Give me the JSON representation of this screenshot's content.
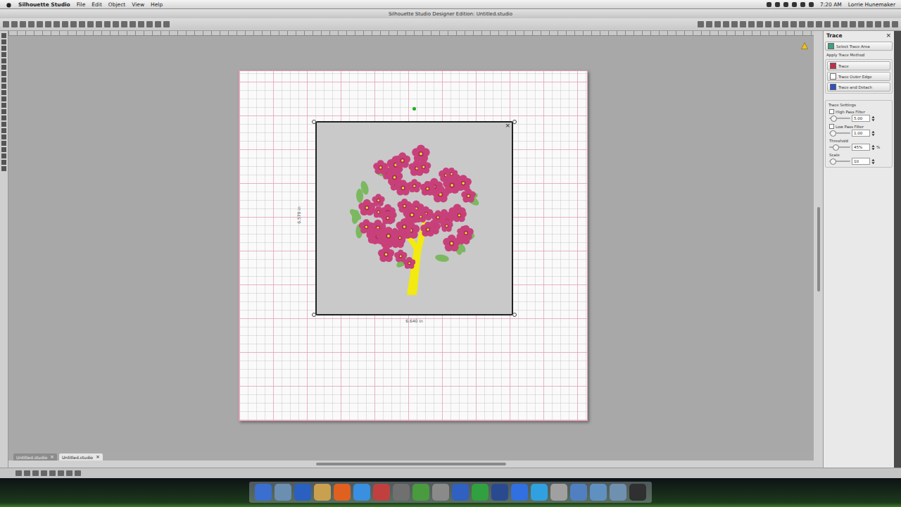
{
  "menubar": {
    "app": "Silhouette Studio",
    "menus": [
      "File",
      "Edit",
      "Object",
      "View",
      "Help"
    ],
    "clock": "7:20 AM",
    "user": "Lorrie Hunemaker"
  },
  "window": {
    "title": "Silhouette Studio Designer Edition: Untitled.studio"
  },
  "canvas": {
    "width_label": "6.640 in",
    "height_label": "6.570 in"
  },
  "trace_panel": {
    "title": "Trace",
    "close": "×",
    "select_button": "Select Trace Area",
    "method_heading": "Apply Trace Method",
    "methods": [
      {
        "label": "Trace",
        "color": "#c0304a"
      },
      {
        "label": "Trace Outer Edge",
        "color": "#ffffff"
      },
      {
        "label": "Trace and Detach",
        "color": "#3050c0"
      }
    ],
    "settings_heading": "Trace Settings",
    "settings": [
      {
        "label": "High Pass Filter",
        "kind": "checkbox",
        "checked": false,
        "value": "5.00",
        "level": 0.1,
        "suffix": ""
      },
      {
        "label": "Low Pass Filter",
        "kind": "checkbox",
        "checked": false,
        "value": "1.00",
        "level": 0.05,
        "suffix": ""
      },
      {
        "label": "Threshold",
        "kind": "plain",
        "checked": false,
        "value": "45%",
        "level": 0.2,
        "suffix": "%"
      },
      {
        "label": "Scale",
        "kind": "plain",
        "checked": false,
        "value": "10",
        "level": 0.05,
        "suffix": ""
      }
    ]
  },
  "doc_tabs": [
    {
      "label": "Untitled.studio",
      "selected": false,
      "close": "×"
    },
    {
      "label": "Untitled.studio",
      "selected": true,
      "close": "×"
    }
  ]
}
